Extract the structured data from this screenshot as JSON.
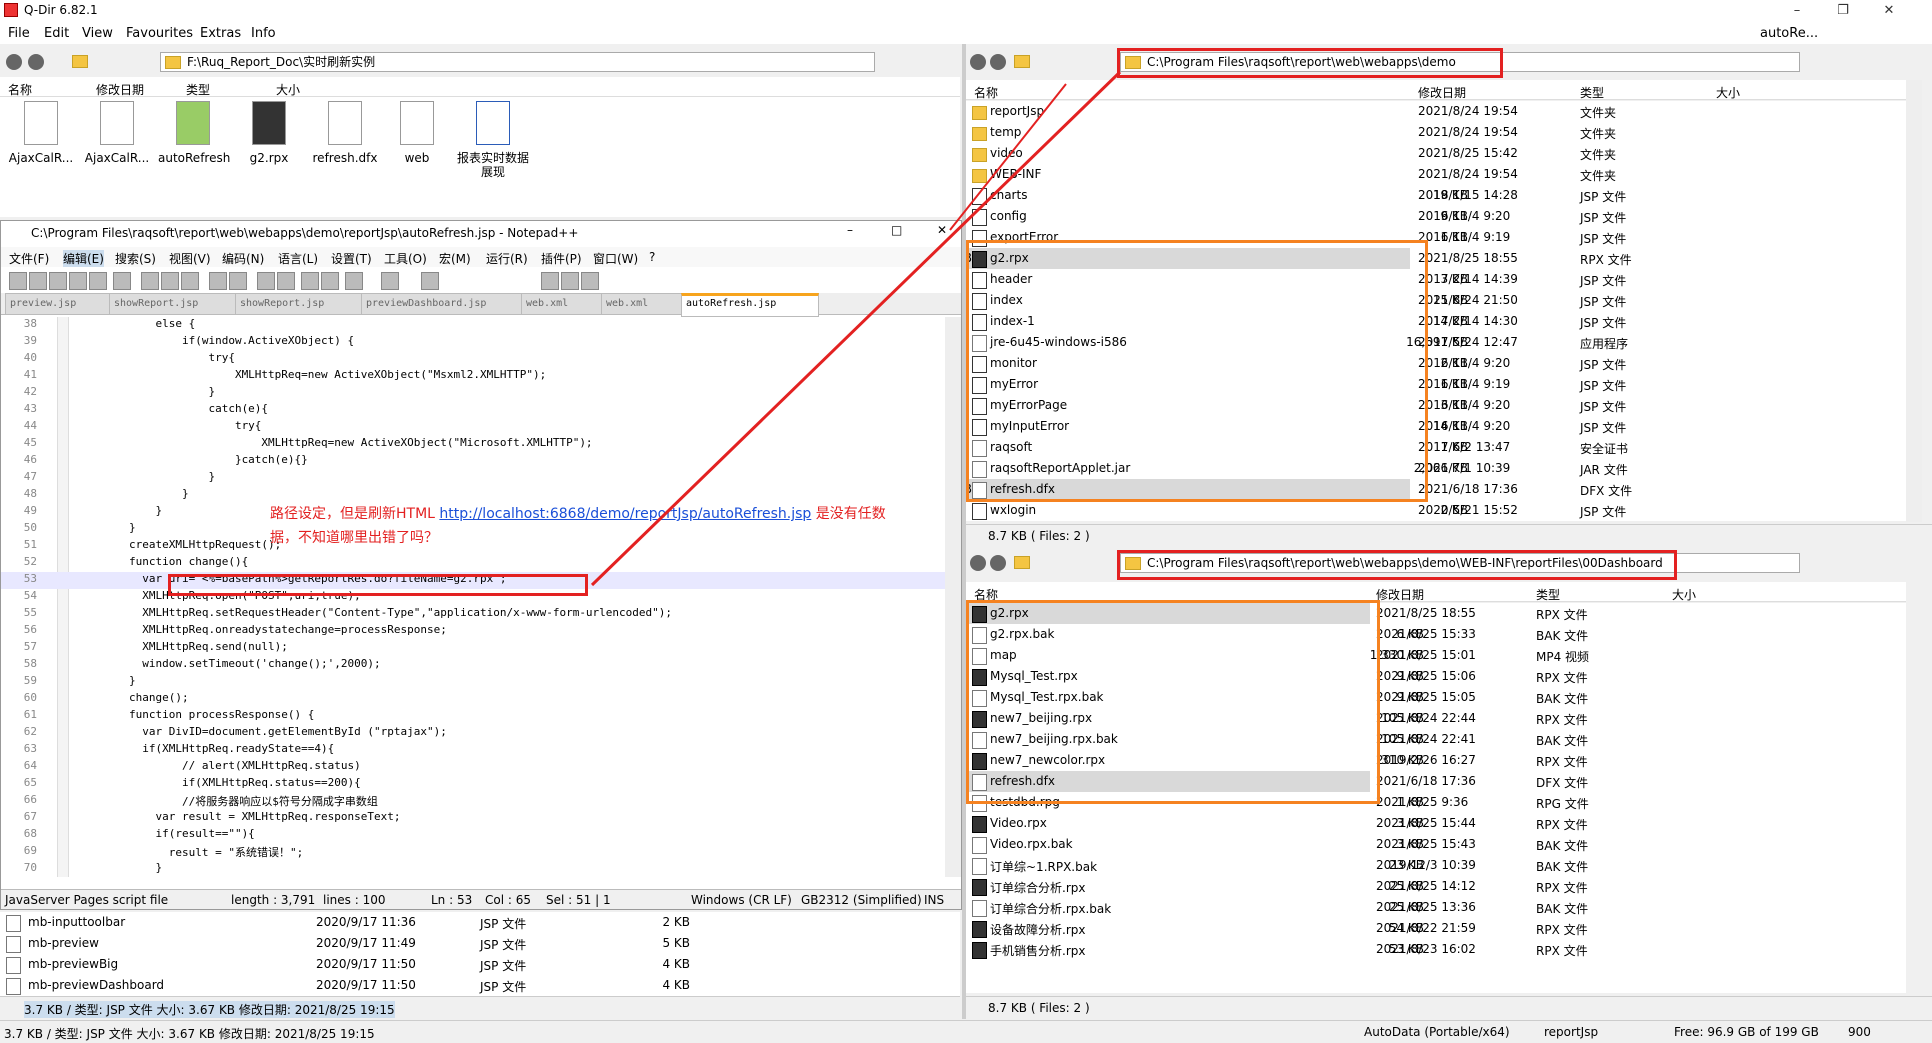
{
  "app": {
    "title": "Q-Dir 6.82.1"
  },
  "menu": [
    "File",
    "Edit",
    "View",
    "Favourites",
    "Extras",
    "Info"
  ],
  "top_right": {
    "label": "autoRe..."
  },
  "left_pane": {
    "path": "F:\\Ruq_Report_Doc\\实时刷新实例",
    "cols": [
      "名称",
      "修改日期",
      "类型",
      "大小"
    ],
    "icons": [
      "AjaxCalR...",
      "AjaxCalR...",
      "autoRefresh",
      "g2.rpx",
      "refresh.dfx",
      "web",
      "报表实时数据展现"
    ],
    "bottom_rows": [
      {
        "name": "mb-inputtoolbar",
        "date": "2020/9/17 11:36",
        "type": "JSP 文件",
        "size": "2 KB"
      },
      {
        "name": "mb-preview",
        "date": "2020/9/17 11:49",
        "type": "JSP 文件",
        "size": "5 KB"
      },
      {
        "name": "mb-previewBig",
        "date": "2020/9/17 11:50",
        "type": "JSP 文件",
        "size": "4 KB"
      },
      {
        "name": "mb-previewDashboard",
        "date": "2020/9/17 11:50",
        "type": "JSP 文件",
        "size": "4 KB"
      }
    ],
    "status": "3.7 KB / 类型: JSP 文件 大小: 3.67 KB 修改日期: 2021/8/25 19:15",
    "bottom_status": "3.7 KB / 类型: JSP 文件 大小: 3.67 KB 修改日期: 2021/8/25 19:15"
  },
  "notepad": {
    "title": "C:\\Program Files\\raqsoft\\report\\web\\webapps\\demo\\reportJsp\\autoRefresh.jsp - Notepad++",
    "menu": [
      "文件(F)",
      "编辑(E)",
      "搜索(S)",
      "视图(V)",
      "编码(N)",
      "语言(L)",
      "设置(T)",
      "工具(O)",
      "宏(M)",
      "运行(R)",
      "插件(P)",
      "窗口(W)",
      "?"
    ],
    "tabs": [
      "preview.jsp",
      "showReport.jsp",
      "showReport.jsp",
      "previewDashboard.jsp",
      "web.xml",
      "web.xml",
      "autoRefresh.jsp"
    ],
    "lines": [
      {
        "n": "38",
        "t": "            else {"
      },
      {
        "n": "39",
        "t": "                if(window.ActiveXObject) {"
      },
      {
        "n": "40",
        "t": "                    try{"
      },
      {
        "n": "41",
        "t": "                        XMLHttpReq=new ActiveXObject(\"Msxml2.XMLHTTP\");"
      },
      {
        "n": "42",
        "t": "                    }"
      },
      {
        "n": "43",
        "t": "                    catch(e){"
      },
      {
        "n": "44",
        "t": "                        try{"
      },
      {
        "n": "45",
        "t": "                            XMLHttpReq=new ActiveXObject(\"Microsoft.XMLHTTP\");"
      },
      {
        "n": "46",
        "t": "                        }catch(e){}"
      },
      {
        "n": "47",
        "t": "                    }"
      },
      {
        "n": "48",
        "t": "                }"
      },
      {
        "n": "49",
        "t": "            }"
      },
      {
        "n": "50",
        "t": "        }"
      },
      {
        "n": "51",
        "t": "        createXMLHttpRequest();"
      },
      {
        "n": "52",
        "t": "        function change(){"
      },
      {
        "n": "53",
        "t": "          var uri=\"<%=basePath%>getReportRes.do?fileName=g2.rpx\";"
      },
      {
        "n": "54",
        "t": "          XMLHttpReq.open(\"POST\",uri,true);"
      },
      {
        "n": "55",
        "t": "          XMLHttpReq.setRequestHeader(\"Content-Type\",\"application/x-www-form-urlencoded\");"
      },
      {
        "n": "56",
        "t": "          XMLHttpReq.onreadystatechange=processResponse;"
      },
      {
        "n": "57",
        "t": "          XMLHttpReq.send(null);"
      },
      {
        "n": "58",
        "t": "          window.setTimeout('change();',2000);"
      },
      {
        "n": "59",
        "t": "        }"
      },
      {
        "n": "60",
        "t": "        change();"
      },
      {
        "n": "61",
        "t": "        function processResponse() {"
      },
      {
        "n": "62",
        "t": "          var DivID=document.getElementById (\"rptajax\");"
      },
      {
        "n": "63",
        "t": "          if(XMLHttpReq.readyState==4){"
      },
      {
        "n": "64",
        "t": "                // alert(XMLHttpReq.status)"
      },
      {
        "n": "65",
        "t": "                if(XMLHttpReq.status==200){"
      },
      {
        "n": "66",
        "t": "                //将服务器响应以$符号分隔成字串数组"
      },
      {
        "n": "67",
        "t": "            var result = XMLHttpReq.responseText;"
      },
      {
        "n": "68",
        "t": "            if(result==\"\"){"
      },
      {
        "n": "69",
        "t": "              result = \"系统错误！\";"
      },
      {
        "n": "70",
        "t": "            }"
      }
    ],
    "status": {
      "type": "JavaServer Pages script file",
      "length": "length : 3,791",
      "lines": "lines : 100",
      "ln": "Ln : 53",
      "col": "Col : 65",
      "sel": "Sel : 51 | 1",
      "eol": "Windows (CR LF)",
      "enc": "GB2312 (Simplified)",
      "mode": "INS"
    }
  },
  "annotation": {
    "line1_pre": "路径设定，但是刷新HTML ",
    "link": "http://localhost:6868/demo/reportJsp/autoRefresh.jsp",
    "line1_post": " 是没有任数",
    "line2": "据，不知道哪里出错了吗？"
  },
  "right_top": {
    "path": "C:\\Program Files\\raqsoft\\report\\web\\webapps\\demo",
    "cols": [
      "名称",
      "修改日期",
      "类型",
      "大小"
    ],
    "rows": [
      {
        "icon": "dir",
        "name": "reportJsp",
        "date": "2021/8/24 19:54",
        "type": "文件夹",
        "size": ""
      },
      {
        "icon": "dir",
        "name": "temp",
        "date": "2021/8/24 19:54",
        "type": "文件夹",
        "size": ""
      },
      {
        "icon": "dir",
        "name": "video",
        "date": "2021/8/25 15:42",
        "type": "文件夹",
        "size": ""
      },
      {
        "icon": "dir",
        "name": "WEB-INF",
        "date": "2021/8/24 19:54",
        "type": "文件夹",
        "size": ""
      },
      {
        "icon": "jsp",
        "name": "charts",
        "date": "2018/1/15 14:28",
        "type": "JSP 文件",
        "size": "19 KB"
      },
      {
        "icon": "jsp",
        "name": "config",
        "date": "2016/11/4 9:20",
        "type": "JSP 文件",
        "size": "9 KB"
      },
      {
        "icon": "jsp",
        "name": "exportError",
        "date": "2016/11/4 9:19",
        "type": "JSP 文件",
        "size": "1 KB"
      },
      {
        "icon": "rpx",
        "name": "g2.rpx",
        "date": "2021/8/25 18:55",
        "type": "RPX 文件",
        "size": "6 KB",
        "sel": true
      },
      {
        "icon": "jsp",
        "name": "header",
        "date": "2017/2/14 14:39",
        "type": "JSP 文件",
        "size": "3 KB"
      },
      {
        "icon": "jsp",
        "name": "index",
        "date": "2021/8/24 21:50",
        "type": "JSP 文件",
        "size": "15 KB"
      },
      {
        "icon": "jsp",
        "name": "index-1",
        "date": "2017/2/14 14:30",
        "type": "JSP 文件",
        "size": "14 KB"
      },
      {
        "icon": "exe",
        "name": "jre-6u45-windows-i586",
        "date": "2017/5/24 12:47",
        "type": "应用程序",
        "size": "16,691 KB"
      },
      {
        "icon": "jsp",
        "name": "monitor",
        "date": "2016/11/4 9:20",
        "type": "JSP 文件",
        "size": "2 KB"
      },
      {
        "icon": "jsp",
        "name": "myError",
        "date": "2016/11/4 9:19",
        "type": "JSP 文件",
        "size": "1 KB"
      },
      {
        "icon": "jsp",
        "name": "myErrorPage",
        "date": "2016/11/4 9:20",
        "type": "JSP 文件",
        "size": "3 KB"
      },
      {
        "icon": "jsp",
        "name": "myInputError",
        "date": "2016/11/4 9:20",
        "type": "JSP 文件",
        "size": "14 KB"
      },
      {
        "icon": "cert",
        "name": "raqsoft",
        "date": "2017/6/2 13:47",
        "type": "安全证书",
        "size": "1 KB"
      },
      {
        "icon": "file",
        "name": "raqsoftReportApplet.jar",
        "date": "2021/7/1 10:39",
        "type": "JAR 文件",
        "size": "2,066 KB"
      },
      {
        "icon": "file",
        "name": "refresh.dfx",
        "date": "2021/6/18 17:36",
        "type": "DFX 文件",
        "size": "4 KB",
        "sel": true
      },
      {
        "icon": "jsp",
        "name": "wxlogin",
        "date": "2020/5/21 15:52",
        "type": "JSP 文件",
        "size": "2 KB"
      }
    ],
    "status": "8.7 KB ( Files: 2 )"
  },
  "right_bottom": {
    "path": "C:\\Program Files\\raqsoft\\report\\web\\webapps\\demo\\WEB-INF\\reportFiles\\00Dashboard",
    "cols": [
      "名称",
      "修改日期",
      "类型",
      "大小"
    ],
    "rows": [
      {
        "icon": "rpx",
        "name": "g2.rpx",
        "date": "2021/8/25 18:55",
        "type": "RPX 文件",
        "size": "6 KB",
        "sel": true
      },
      {
        "icon": "file",
        "name": "g2.rpx.bak",
        "date": "2021/8/25 15:33",
        "type": "BAK 文件",
        "size": "6 KB"
      },
      {
        "icon": "file",
        "name": "map",
        "date": "2021/8/25 15:01",
        "type": "MP4 视频",
        "size": "1,330 KB"
      },
      {
        "icon": "rpx",
        "name": "Mysql_Test.rpx",
        "date": "2021/8/25 15:06",
        "type": "RPX 文件",
        "size": "9 KB"
      },
      {
        "icon": "file",
        "name": "Mysql_Test.rpx.bak",
        "date": "2021/8/25 15:05",
        "type": "BAK 文件",
        "size": "9 KB"
      },
      {
        "icon": "rpx",
        "name": "new7_beijing.rpx",
        "date": "2021/8/24 22:44",
        "type": "RPX 文件",
        "size": "105 KB"
      },
      {
        "icon": "file",
        "name": "new7_beijing.rpx.bak",
        "date": "2021/8/24 22:41",
        "type": "BAK 文件",
        "size": "105 KB"
      },
      {
        "icon": "rpx",
        "name": "new7_newcolor.rpx",
        "date": "2019/2/26 16:27",
        "type": "RPX 文件",
        "size": "310 KB"
      },
      {
        "icon": "file",
        "name": "refresh.dfx",
        "date": "2021/6/18 17:36",
        "type": "DFX 文件",
        "size": "4 KB",
        "sel": true
      },
      {
        "icon": "file",
        "name": "testdbd.rpg",
        "date": "2021/8/25 9:36",
        "type": "RPG 文件",
        "size": "1 KB"
      },
      {
        "icon": "rpx",
        "name": "Video.rpx",
        "date": "2021/8/25 15:44",
        "type": "RPX 文件",
        "size": "3 KB"
      },
      {
        "icon": "file",
        "name": "Video.rpx.bak",
        "date": "2021/8/25 15:43",
        "type": "BAK 文件",
        "size": "3 KB"
      },
      {
        "icon": "file",
        "name": "订单综~1.RPX.bak",
        "date": "2019/12/3 10:39",
        "type": "BAK 文件",
        "size": "23 KB"
      },
      {
        "icon": "rpx",
        "name": "订单综合分析.rpx",
        "date": "2021/8/25 14:12",
        "type": "RPX 文件",
        "size": "25 KB"
      },
      {
        "icon": "file",
        "name": "订单综合分析.rpx.bak",
        "date": "2021/8/25 13:36",
        "type": "BAK 文件",
        "size": "25 KB"
      },
      {
        "icon": "rpx",
        "name": "设备故障分析.rpx",
        "date": "2021/8/22 21:59",
        "type": "RPX 文件",
        "size": "54 KB"
      },
      {
        "icon": "rpx",
        "name": "手机销售分析.rpx",
        "date": "2021/8/23 16:02",
        "type": "RPX 文件",
        "size": "53 KB"
      }
    ],
    "status": "8.7 KB ( Files: 2 )"
  },
  "global_status": {
    "autodata": "AutoData (Portable/x64)",
    "folder": "reportJsp",
    "free": "Free: 96.9 GB of 199 GB",
    "num": "900"
  }
}
